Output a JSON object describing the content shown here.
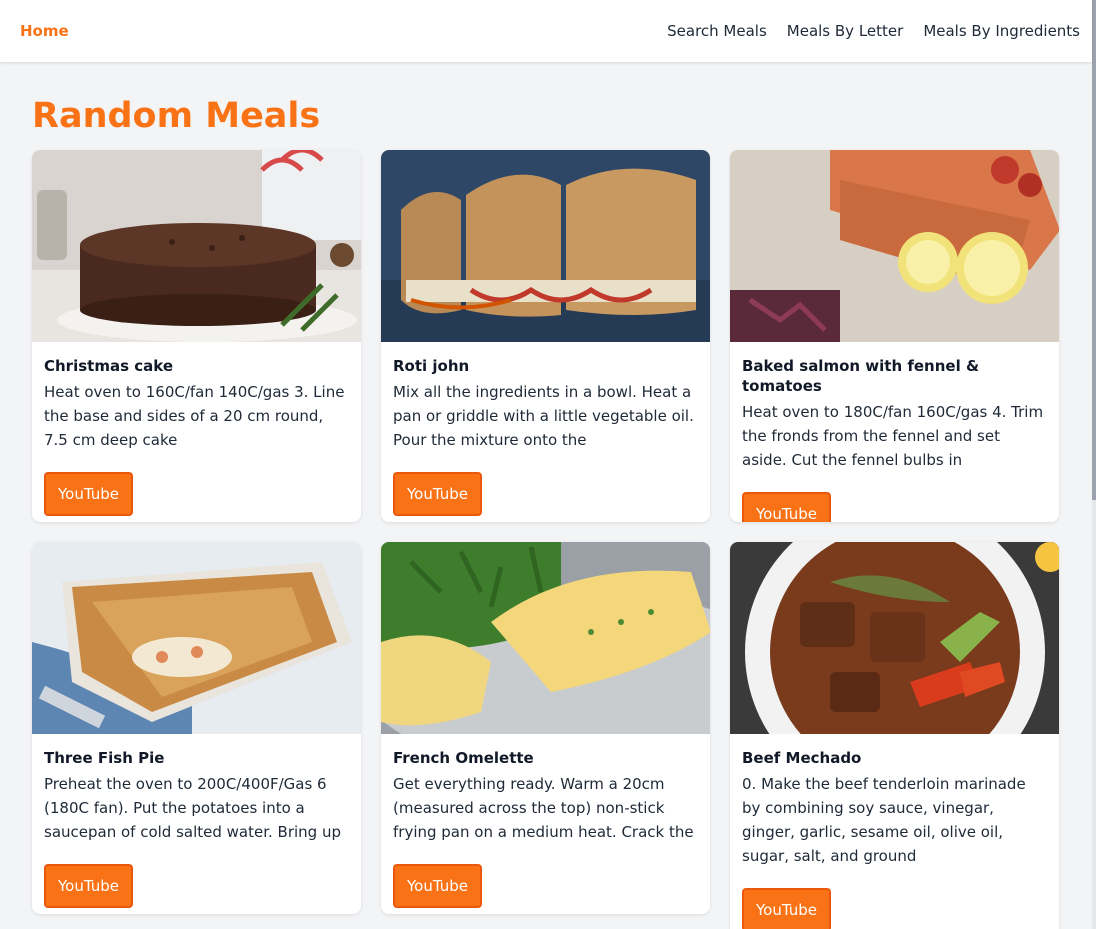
{
  "nav": {
    "home": "Home",
    "links": [
      "Search Meals",
      "Meals By Letter",
      "Meals By Ingredients"
    ]
  },
  "page": {
    "title": "Random Meals"
  },
  "accent_color": "#f97316",
  "meals": [
    {
      "title": "Christmas cake",
      "description": "Heat oven to 160C/fan 140C/gas 3. Line the base and sides of a 20 cm round, 7.5 cm deep cake",
      "button": "YouTube"
    },
    {
      "title": "Roti john",
      "description": "Mix all the ingredients in a bowl. Heat a pan or griddle with a little vegetable oil. Pour the mixture onto the",
      "button": "YouTube"
    },
    {
      "title": "Baked salmon with fennel & tomatoes",
      "description": "Heat oven to 180C/fan 160C/gas 4. Trim the fronds from the fennel and set aside. Cut the fennel bulbs in",
      "button": "YouTube"
    },
    {
      "title": "Three Fish Pie",
      "description": "Preheat the oven to 200C/400F/Gas 6 (180C fan). Put the potatoes into a saucepan of cold salted water. Bring up to",
      "button": "YouTube"
    },
    {
      "title": "French Omelette",
      "description": "Get everything ready. Warm a 20cm (measured across the top) non-stick frying pan on a medium heat. Crack the eggs",
      "button": "YouTube"
    },
    {
      "title": "Beef Mechado",
      "description": "0. Make the beef tenderloin marinade by combining soy sauce, vinegar, ginger, garlic, sesame oil, olive oil, sugar, salt, and ground",
      "button": "YouTube"
    }
  ]
}
